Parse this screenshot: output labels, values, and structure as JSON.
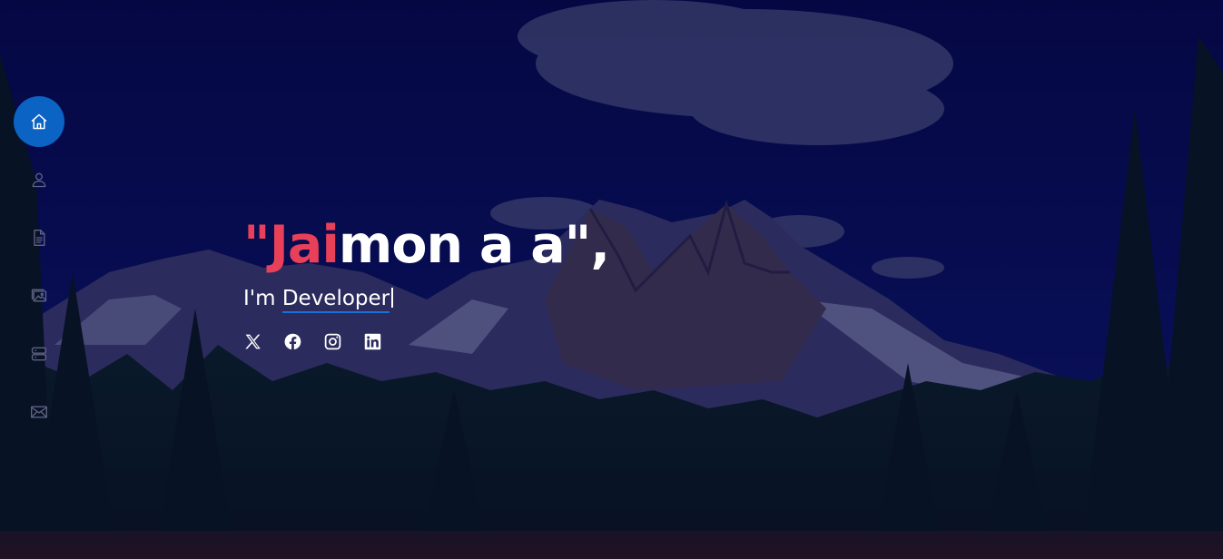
{
  "hero": {
    "title_accent": "\"Jai",
    "title_rest": "mon a a\",",
    "subtitle_prefix": "I'm ",
    "typed_word": "Developer"
  },
  "side_nav": {
    "items": [
      {
        "icon": "home-icon",
        "active": true
      },
      {
        "icon": "person-icon",
        "active": false
      },
      {
        "icon": "document-icon",
        "active": false
      },
      {
        "icon": "images-icon",
        "active": false
      },
      {
        "icon": "server-icon",
        "active": false
      },
      {
        "icon": "envelope-icon",
        "active": false
      }
    ]
  },
  "social": {
    "items": [
      {
        "icon": "x-twitter-icon"
      },
      {
        "icon": "facebook-icon"
      },
      {
        "icon": "instagram-icon"
      },
      {
        "icon": "linkedin-icon"
      }
    ]
  },
  "colors": {
    "accent": "#e84058",
    "nav_active": "#0b63c4",
    "overlay": "#04063c",
    "underline": "#1b6fd6"
  }
}
